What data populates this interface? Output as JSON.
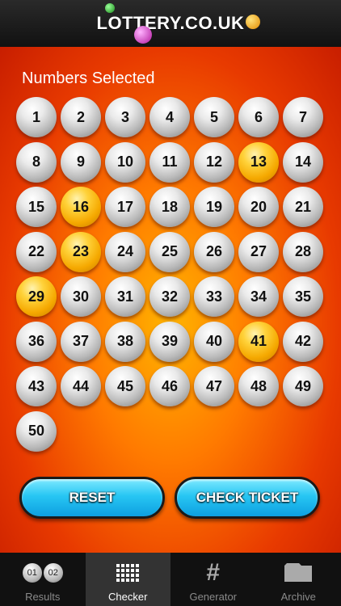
{
  "header": {
    "logo_text": "LOTTERY.CO.UK"
  },
  "main": {
    "title": "Numbers Selected",
    "balls": [
      {
        "n": "1",
        "sel": false
      },
      {
        "n": "2",
        "sel": false
      },
      {
        "n": "3",
        "sel": false
      },
      {
        "n": "4",
        "sel": false
      },
      {
        "n": "5",
        "sel": false
      },
      {
        "n": "6",
        "sel": false
      },
      {
        "n": "7",
        "sel": false
      },
      {
        "n": "8",
        "sel": false
      },
      {
        "n": "9",
        "sel": false
      },
      {
        "n": "10",
        "sel": false
      },
      {
        "n": "11",
        "sel": false
      },
      {
        "n": "12",
        "sel": false
      },
      {
        "n": "13",
        "sel": true
      },
      {
        "n": "14",
        "sel": false
      },
      {
        "n": "15",
        "sel": false
      },
      {
        "n": "16",
        "sel": true
      },
      {
        "n": "17",
        "sel": false
      },
      {
        "n": "18",
        "sel": false
      },
      {
        "n": "19",
        "sel": false
      },
      {
        "n": "20",
        "sel": false
      },
      {
        "n": "21",
        "sel": false
      },
      {
        "n": "22",
        "sel": false
      },
      {
        "n": "23",
        "sel": true
      },
      {
        "n": "24",
        "sel": false
      },
      {
        "n": "25",
        "sel": false
      },
      {
        "n": "26",
        "sel": false
      },
      {
        "n": "27",
        "sel": false
      },
      {
        "n": "28",
        "sel": false
      },
      {
        "n": "29",
        "sel": true
      },
      {
        "n": "30",
        "sel": false
      },
      {
        "n": "31",
        "sel": false
      },
      {
        "n": "32",
        "sel": false
      },
      {
        "n": "33",
        "sel": false
      },
      {
        "n": "34",
        "sel": false
      },
      {
        "n": "35",
        "sel": false
      },
      {
        "n": "36",
        "sel": false
      },
      {
        "n": "37",
        "sel": false
      },
      {
        "n": "38",
        "sel": false
      },
      {
        "n": "39",
        "sel": false
      },
      {
        "n": "40",
        "sel": false
      },
      {
        "n": "41",
        "sel": true
      },
      {
        "n": "42",
        "sel": false
      },
      {
        "n": "43",
        "sel": false
      },
      {
        "n": "44",
        "sel": false
      },
      {
        "n": "45",
        "sel": false
      },
      {
        "n": "46",
        "sel": false
      },
      {
        "n": "47",
        "sel": false
      },
      {
        "n": "48",
        "sel": false
      },
      {
        "n": "49",
        "sel": false
      },
      {
        "n": "50",
        "sel": false
      }
    ]
  },
  "buttons": {
    "reset_label": "RESET",
    "check_label": "CHECK TICKET"
  },
  "tabbar": {
    "results_icon_numbers": [
      "01",
      "02"
    ],
    "items": [
      {
        "label": "Results",
        "icon": "results-balls-icon",
        "active": false
      },
      {
        "label": "Checker",
        "icon": "grid-icon",
        "active": true
      },
      {
        "label": "Generator",
        "icon": "hash-icon",
        "active": false
      },
      {
        "label": "Archive",
        "icon": "folder-icon",
        "active": false
      }
    ]
  },
  "colors": {
    "selected_ball": "#f5a800",
    "unselected_ball": "#d0d0d0",
    "button_blue": "#27c6f3",
    "background_red": "#e83a00"
  }
}
